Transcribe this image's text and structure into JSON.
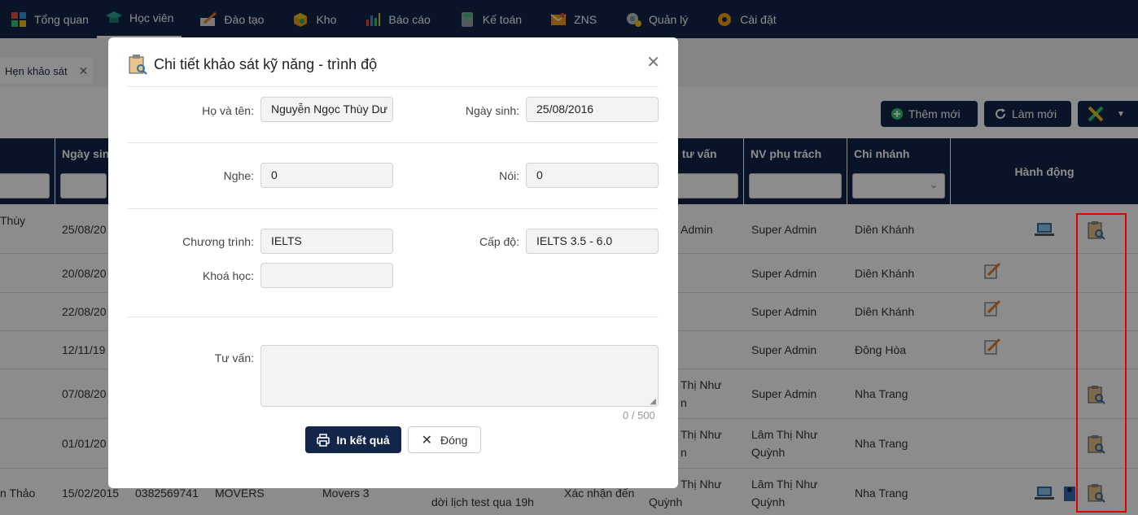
{
  "nav": {
    "items": [
      {
        "label": "Tổng quan",
        "icon": "dashboard-icon"
      },
      {
        "label": "Học viên",
        "icon": "graduation-cap-icon"
      },
      {
        "label": "Đào tạo",
        "icon": "book-pen-icon"
      },
      {
        "label": "Kho",
        "icon": "box-icon"
      },
      {
        "label": "Báo cáo",
        "icon": "bar-chart-icon"
      },
      {
        "label": "Kế toán",
        "icon": "calculator-icon"
      },
      {
        "label": "ZNS",
        "icon": "mail-icon"
      },
      {
        "label": "Quản lý",
        "icon": "gear-user-icon"
      },
      {
        "label": "Cài đặt",
        "icon": "gear-icon"
      }
    ]
  },
  "tabs": {
    "active": "Hẹn khảo sát"
  },
  "toolbar": {
    "add": "Thêm mới",
    "refresh": "Làm mới"
  },
  "table": {
    "headers": {
      "birth": "Ngày sin",
      "advisor": "i tư vấn",
      "staff": "NV phụ trách",
      "branch": "Chi nhánh",
      "actions": "Hành động"
    },
    "rows": [
      {
        "name": "Thùy",
        "birth": "25/08/20",
        "advisor": "Admin",
        "staff": "Super Admin",
        "branch": "Diên Khánh"
      },
      {
        "name": "",
        "birth": "20/08/20",
        "advisor": "",
        "staff": "Super Admin",
        "branch": "Diên Khánh"
      },
      {
        "name": "",
        "birth": "22/08/20",
        "advisor": "",
        "staff": "Super Admin",
        "branch": "Diên Khánh"
      },
      {
        "name": "",
        "birth": "12/11/19",
        "advisor": "",
        "staff": "Super Admin",
        "branch": "Đông Hòa"
      },
      {
        "name": "",
        "birth": "07/08/20",
        "advisor": "Thị Như",
        "advisor2": "n",
        "staff": "Super Admin",
        "branch": "Nha Trang"
      },
      {
        "name": "",
        "birth": "01/01/20",
        "advisor": "Thị Như",
        "advisor2": "n",
        "staff": "Lâm Thị Như",
        "staff2": "Quỳnh",
        "branch": "Nha Trang"
      },
      {
        "name": "n Thảo",
        "birth": "15/02/2015",
        "phone": "0382569741",
        "course": "MOVERS",
        "level": "Movers 3",
        "note": "dời lịch test qua 19h",
        "status": "Xác nhận đến",
        "advisor": "Thị Như",
        "advisor2": "Quỳnh",
        "staff": "Lâm Thị Như",
        "staff2": "Quỳnh",
        "branch": "Nha Trang"
      }
    ]
  },
  "modal": {
    "title": "Chi tiết khảo sát kỹ năng - trình độ",
    "fields": {
      "name_label": "Họ và tên:",
      "name_value": "Nguyễn Ngọc Thùy Dư",
      "dob_label": "Ngày sinh:",
      "dob_value": "25/08/2016",
      "listen_label": "Nghe:",
      "listen_value": "0",
      "speak_label": "Nói:",
      "speak_value": "0",
      "program_label": "Chương trình:",
      "program_value": "IELTS",
      "level_label": "Cấp độ:",
      "level_value": "IELTS 3.5 - 6.0",
      "course_label": "Khoá học:",
      "course_value": "",
      "advice_label": "Tư vấn:",
      "advice_counter": "0 / 500"
    },
    "buttons": {
      "print": "In kết quả",
      "close": "Đóng"
    }
  }
}
